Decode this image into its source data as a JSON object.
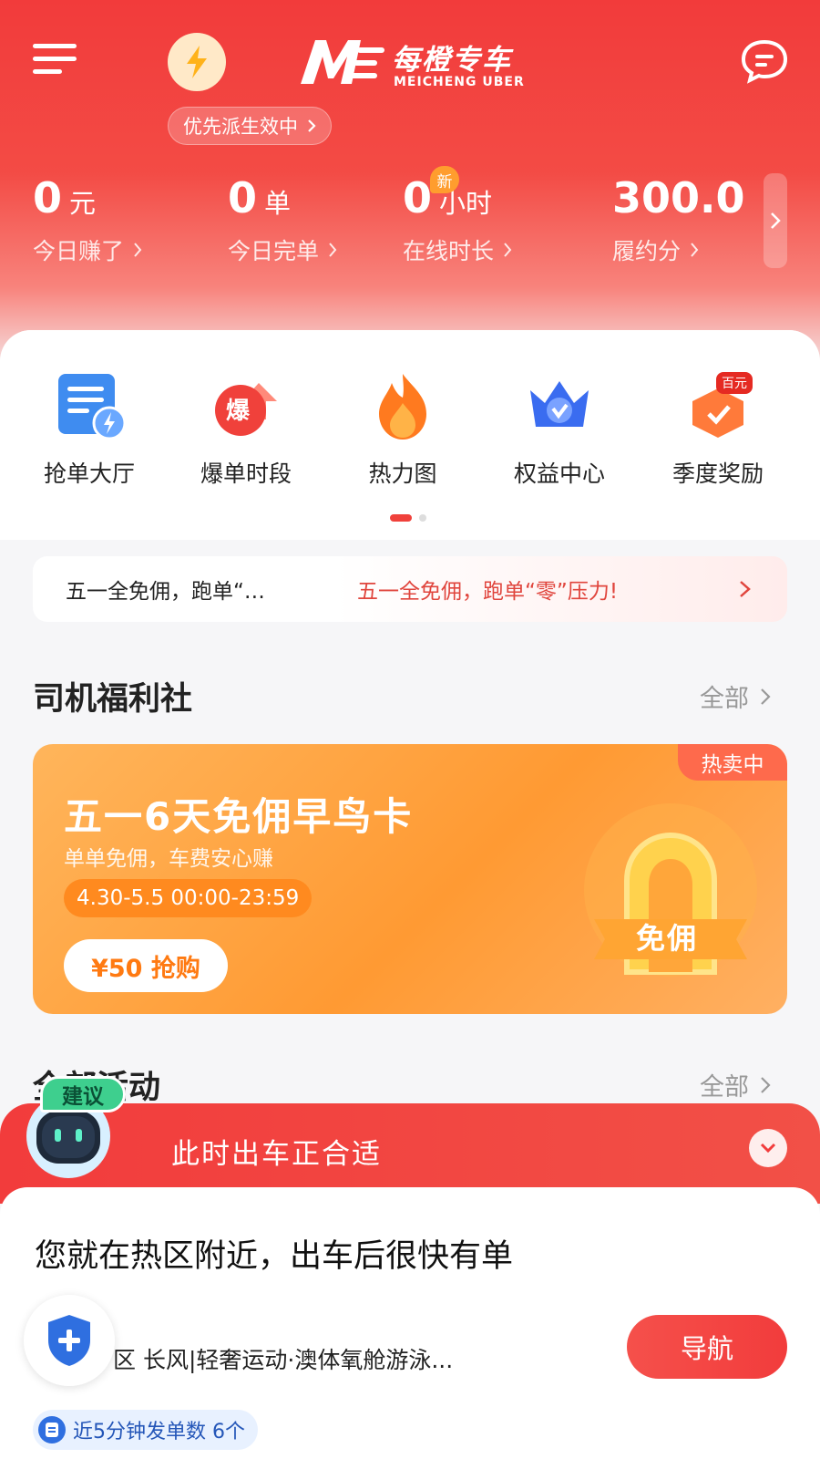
{
  "header": {
    "priority_pill": "优先派生效中",
    "logo_cn": "每橙专车",
    "logo_en": "MEICHENG UBER",
    "icons": [
      "menu-icon",
      "lightning-icon",
      "chat-icon"
    ]
  },
  "stats": [
    {
      "value": "0",
      "unit": "元",
      "label": "今日赚了"
    },
    {
      "value": "0",
      "unit": "单",
      "label": "今日完单"
    },
    {
      "value": "0",
      "unit": "小时",
      "label": "在线时长",
      "badge": "新"
    },
    {
      "value": "300.0",
      "unit": "",
      "label": "履约分"
    }
  ],
  "quick_items": [
    {
      "label": "抢单大厅",
      "icon": "order-hall-icon"
    },
    {
      "label": "爆单时段",
      "icon": "surge-icon",
      "icon_text": "爆"
    },
    {
      "label": "热力图",
      "icon": "flame-icon"
    },
    {
      "label": "权益中心",
      "icon": "crown-icon"
    },
    {
      "label": "季度奖励",
      "icon": "reward-icon",
      "icon_text": "百元"
    }
  ],
  "notice": {
    "left": "五一全免佣，跑单“…",
    "right": "五一全免佣，跑单“零”压力!"
  },
  "welfare": {
    "title": "司机福利社",
    "more": "全部"
  },
  "promo": {
    "tag": "热卖中",
    "title": "五一6天免佣早鸟卡",
    "subtitle": "单单免佣，车费安心赚",
    "date": "4.30-5.5 00:00-23:59",
    "buy": "¥50 抢购",
    "badge_text": "免佣"
  },
  "activities": {
    "title": "全部活动",
    "more": "全部"
  },
  "suggestion": {
    "robot_tag": "建议",
    "text": "此时出车正合适"
  },
  "sheet": {
    "title": "您就在热区附近，出车后很快有单",
    "location": "区 长风|轻奢运动·澳体氧舱游泳...",
    "nav_button": "导航",
    "orders": "近5分钟发单数 6个"
  },
  "colors": {
    "primary_red": "#f23c3c",
    "orange": "#ff9a33",
    "blue": "#2f6fe0"
  }
}
